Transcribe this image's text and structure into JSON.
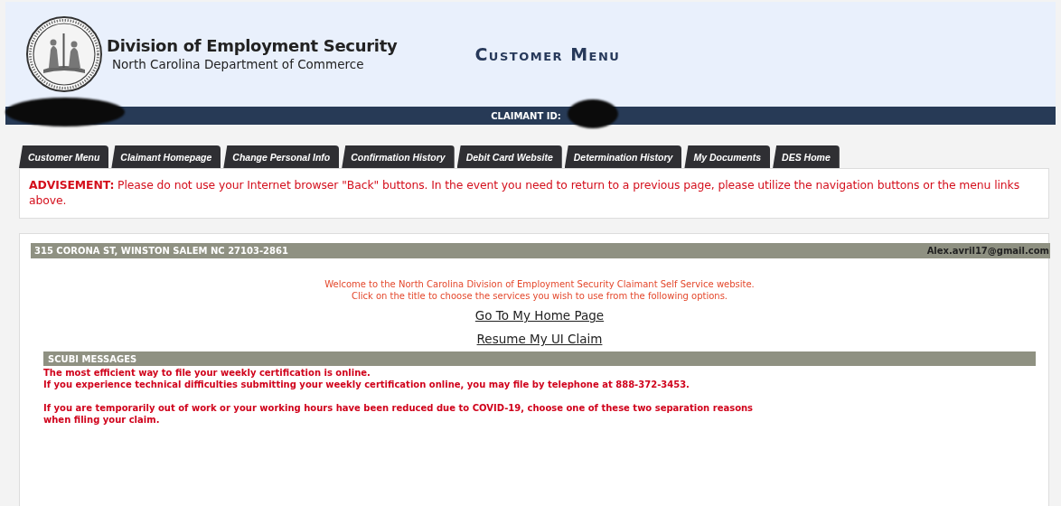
{
  "header": {
    "agency": "Division of Employment Security",
    "department": "North Carolina Department of Commerce",
    "page_title": "Customer Menu"
  },
  "claimant_bar": {
    "label": "CLAIMANT ID:"
  },
  "tabs": [
    {
      "label": "Customer Menu"
    },
    {
      "label": "Claimant Homepage"
    },
    {
      "label": "Change Personal Info"
    },
    {
      "label": "Confirmation History"
    },
    {
      "label": "Debit Card Website"
    },
    {
      "label": "Determination History"
    },
    {
      "label": "My Documents"
    },
    {
      "label": "DES Home"
    }
  ],
  "advisement": "**ADVISEMENT:** Please do not use your Internet browser \"Back\" buttons. In the event you need to return to a previous page, please utilize the navigation buttons or the menu links above.",
  "info_bar": {
    "address": "315 CORONA ST, WINSTON SALEM NC 27103-2861",
    "email": "Alex.avril17@gmail.com"
  },
  "welcome": [
    "Welcome to the North Carolina Division of Employment Security Claimant Self Service website.",
    "Click on the title to choose the services you wish to use from the following options."
  ],
  "links": [
    "Go To My Home Page",
    "Resume My UI Claim"
  ],
  "messages": {
    "title": "SCUBI MESSAGES",
    "paragraphs": [
      [
        "The most efficient way to file your weekly certification is online.",
        "If you experience technical difficulties submitting your weekly certification online, you may file by telephone at 888-372-3453."
      ],
      [
        "If you are temporarily out of work or your working hours have been reduced due to COVID-19, choose one of these two separation reasons when filing your claim."
      ]
    ]
  }
}
